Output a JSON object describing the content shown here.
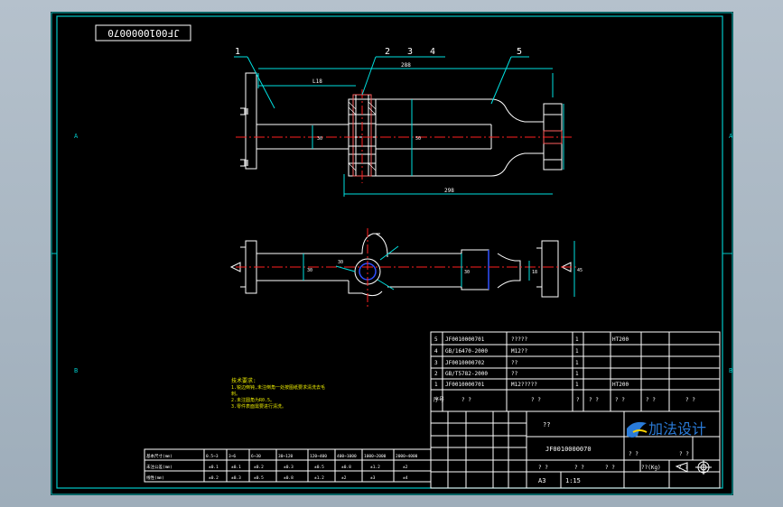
{
  "drawing_number_box": "JF0010000070",
  "balloons": [
    "1",
    "2",
    "3",
    "4",
    "5"
  ],
  "dimensions": {
    "overall_top": "288",
    "l18": "L18",
    "bottom_length": "298",
    "diameters_top": [
      "30",
      "50"
    ],
    "side_view": [
      "30",
      "30",
      "18",
      "45",
      "30"
    ]
  },
  "zone_letters": {
    "left_top": "A",
    "left_mid": "B",
    "right_top": "A",
    "right_mid": "B"
  },
  "tech_notes": {
    "title": "技术要求:",
    "items": [
      "1.锐边倒钝,未注倒角一处按图纸要求清洗去毛",
      "  刺。",
      "2.未注圆角为R0.5。",
      "3.零件表面需要进行清洗。"
    ]
  },
  "bom": {
    "rows": [
      {
        "no": "5",
        "code": "JF0010000701",
        "name": "?????",
        "qty": "1",
        "material": "HT200"
      },
      {
        "no": "4",
        "code": "GB/16470-2000",
        "name": "M12??",
        "qty": "1",
        "material": ""
      },
      {
        "no": "3",
        "code": "JF0010000702",
        "name": "??",
        "qty": "1",
        "material": ""
      },
      {
        "no": "2",
        "code": "GB/T5782-2000",
        "name": "??",
        "qty": "1",
        "material": ""
      },
      {
        "no": "1",
        "code": "JF0010000701",
        "name": "M12?????",
        "qty": "1",
        "material": "HT200"
      }
    ],
    "header": {
      "no": "序号",
      "code": "? ?",
      "name": "? ?",
      "qty": "?",
      "material": "? ?",
      "single": "? ?",
      "total": "? ?",
      "remark": "? ?"
    }
  },
  "title_block": {
    "part_name": "??",
    "drawing_no": "JF0010000070",
    "logo_text": "加法设计",
    "sheet_size": "A3",
    "scale": "1:15",
    "weight_label": "??(Kg)",
    "small_labels": [
      "? ?",
      "? ?",
      "? ?",
      "? ?",
      "? ?",
      "? ?"
    ]
  },
  "tolerance_table": {
    "row_labels": [
      "基本尺寸(mm)",
      "未注公差(mm)",
      "线性(mm)"
    ],
    "header": [
      "0.5~3",
      "3~6",
      "6~30",
      "30~120",
      "120~400",
      "400~1000",
      "1000~2000",
      "2000~4000"
    ],
    "row1": [
      "±0.1",
      "±0.1",
      "±0.2",
      "±0.3",
      "±0.5",
      "±0.8",
      "±1.2",
      "±2"
    ],
    "row2": [
      "±0.2",
      "±0.3",
      "±0.5",
      "±0.8",
      "±1.2",
      "±2",
      "±3",
      "±4"
    ]
  },
  "colors": {
    "line": "#ffffff",
    "frame": "#00c8c8",
    "dim": "#00e0e0",
    "center": "#ff2020",
    "blue": "#3050ff",
    "yellow": "#e8e800",
    "green": "#40e040"
  }
}
